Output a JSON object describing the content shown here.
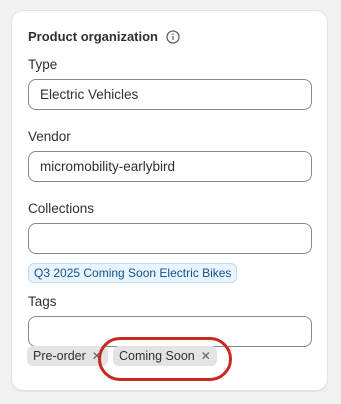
{
  "section": {
    "title": "Product organization",
    "info_icon": "info-circle-icon"
  },
  "type": {
    "label": "Type",
    "value": "Electric Vehicles"
  },
  "vendor": {
    "label": "Vendor",
    "value": "micromobility-earlybird"
  },
  "collections": {
    "label": "Collections",
    "value": "",
    "selected": [
      "Q3 2025 Coming Soon Electric Bikes"
    ]
  },
  "tags": {
    "label": "Tags",
    "value": "",
    "items": [
      {
        "label": "Pre-order",
        "remove_icon": "close-icon"
      },
      {
        "label": "Coming Soon",
        "remove_icon": "close-icon"
      }
    ]
  },
  "colors": {
    "highlight": "#c8281e",
    "collection_tag_bg": "#eaf4ff",
    "tag_bg": "#e3e3e3"
  }
}
